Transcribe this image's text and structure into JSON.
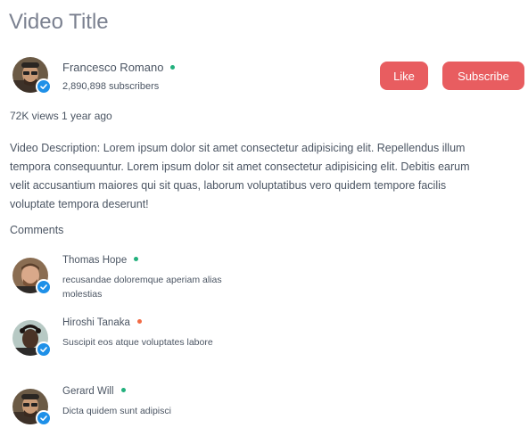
{
  "video": {
    "title": "Video Title",
    "views_line": "72K views 1 year ago",
    "description": "Video Description: Lorem ipsum dolor sit amet consectetur adipisicing elit. Repellendus illum tempora consequuntur. Lorem ipsum dolor sit amet consectetur adipisicing elit. Debitis earum velit accusantium maiores qui sit quas, laborum voluptatibus vero quidem tempore facilis voluptate tempora deserunt!"
  },
  "channel": {
    "name": "Francesco Romano",
    "subscribers": "2,890,898 subscribers",
    "status_color": "#22b07d"
  },
  "actions": {
    "like_label": "Like",
    "subscribe_label": "Subscribe",
    "button_color": "#e85d60"
  },
  "comments": {
    "heading": "Comments",
    "items": [
      {
        "author": "Thomas Hope",
        "status_color": "#22b07d",
        "text": "recusandae doloremque aperiam alias molestias"
      },
      {
        "author": "Hiroshi Tanaka",
        "status_color": "#f26b45",
        "text": "Suscipit eos atque voluptates labore"
      },
      {
        "author": "Gerard Will",
        "status_color": "#22b07d",
        "text": "Dicta quidem sunt adipisci"
      }
    ]
  },
  "colors": {
    "verified_badge": "#1e90e8",
    "title_text": "#7b8190",
    "body_text": "#4b5563"
  }
}
